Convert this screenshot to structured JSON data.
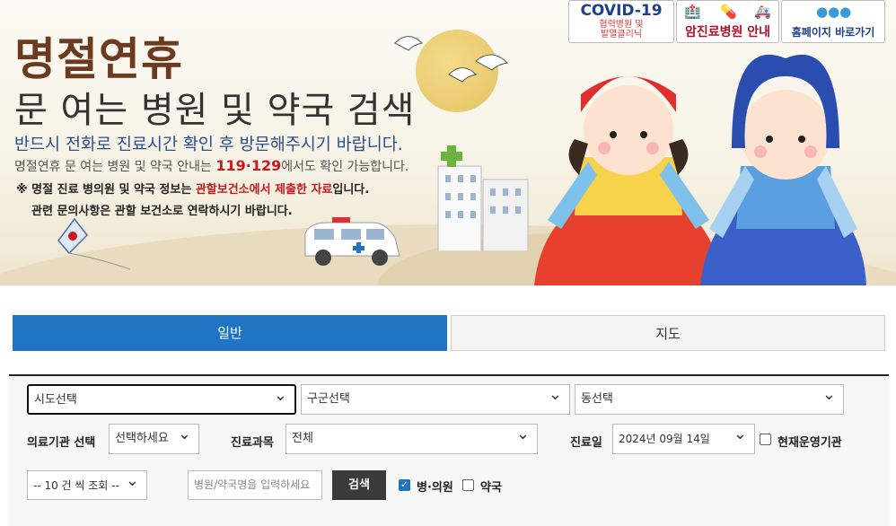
{
  "banner": {
    "title_main": "명절연휴",
    "title_sub": "문 여는 병원 및 약국 검색",
    "notice1": "반드시 전화로 진료시간 확인 후 방문해주시기 바랍니다.",
    "notice2_pre": "명절연휴 문 여는 병원 및 약국 안내는 ",
    "notice2_num": "119·129",
    "notice2_post": "에서도 확인 가능합니다.",
    "notice3_pre": "※ 명절 진료 병의원 및 약국 정보는 ",
    "notice3_red": "관할보건소에서 제출한 자료",
    "notice3_post": "입니다.",
    "notice4": "관련 문의사항은 관할 보건소로 연락하시기 바랍니다."
  },
  "top_buttons": {
    "covid_title": "COVID-19",
    "covid_sub1": "협력병원 및",
    "covid_sub2": "발열클리닉",
    "cancer": "암진료병원 안내",
    "homepage": "홈페이지 바로가기"
  },
  "tabs": {
    "general": "일반",
    "map": "지도"
  },
  "form": {
    "sido": "시도선택",
    "gugun": "구군선택",
    "dong": "동선택",
    "inst_label": "의료기관 선택",
    "inst_value": "선택하세요",
    "dept_label": "진료과목",
    "dept_value": "전체",
    "date_label": "진료일",
    "date_value": "2024년 09월 14일",
    "open_now_label": "현재운영기관",
    "page_size": "-- 10 건 씩 조회 --",
    "search_placeholder": "병원/약국명을 입력하세요",
    "search_button": "검색",
    "hospital_label": "병·의원",
    "pharmacy_label": "약국"
  }
}
